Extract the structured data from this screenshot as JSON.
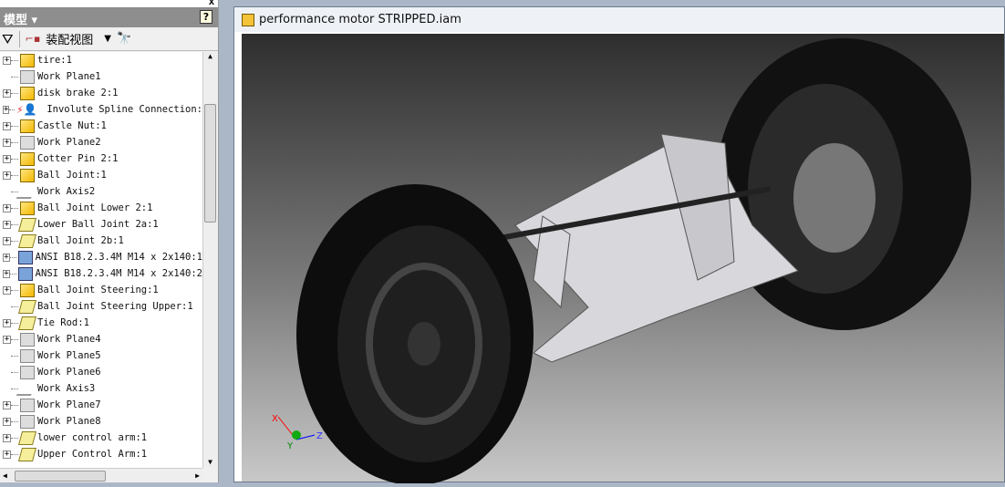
{
  "panel": {
    "title": "模型",
    "help": "?",
    "close": "x",
    "toolbar": {
      "view_label": "装配视图"
    }
  },
  "tree": [
    {
      "label": "tire:1",
      "icon": "part",
      "exp": true
    },
    {
      "label": "Work Plane1",
      "icon": "plane",
      "exp": false
    },
    {
      "label": "disk brake 2:1",
      "icon": "part",
      "exp": true
    },
    {
      "label": "Involute Spline Connection:",
      "icon": "design-accelerator",
      "exp": true
    },
    {
      "label": "Castle Nut:1",
      "icon": "part",
      "exp": true
    },
    {
      "label": "Work Plane2",
      "icon": "plane",
      "exp": true
    },
    {
      "label": "Cotter Pin 2:1",
      "icon": "part",
      "exp": true
    },
    {
      "label": "Ball Joint:1",
      "icon": "part",
      "exp": true
    },
    {
      "label": "Work Axis2",
      "icon": "axis",
      "exp": false
    },
    {
      "label": "Ball Joint Lower 2:1",
      "icon": "part",
      "exp": true
    },
    {
      "label": "Lower Ball Joint 2a:1",
      "icon": "flex",
      "exp": true
    },
    {
      "label": "Ball Joint 2b:1",
      "icon": "flex",
      "exp": true
    },
    {
      "label": "ANSI B18.2.3.4M M14 x 2x140:1",
      "icon": "bolt",
      "exp": true
    },
    {
      "label": "ANSI B18.2.3.4M M14 x 2x140:2",
      "icon": "bolt",
      "exp": true
    },
    {
      "label": "Ball Joint Steering:1",
      "icon": "part",
      "exp": true
    },
    {
      "label": "Ball Joint Steering Upper:1",
      "icon": "flex",
      "exp": false
    },
    {
      "label": "Tie Rod:1",
      "icon": "flex",
      "exp": true
    },
    {
      "label": "Work Plane4",
      "icon": "plane",
      "exp": true
    },
    {
      "label": "Work Plane5",
      "icon": "plane",
      "exp": false
    },
    {
      "label": "Work Plane6",
      "icon": "plane",
      "exp": false
    },
    {
      "label": "Work Axis3",
      "icon": "axis",
      "exp": false
    },
    {
      "label": "Work Plane7",
      "icon": "plane",
      "exp": true
    },
    {
      "label": "Work Plane8",
      "icon": "plane",
      "exp": true
    },
    {
      "label": "lower control arm:1",
      "icon": "flex",
      "exp": true
    },
    {
      "label": "Upper Control Arm:1",
      "icon": "flex",
      "exp": true
    }
  ],
  "document": {
    "title": "performance motor STRIPPED.iam"
  },
  "triad": {
    "x": "X",
    "y": "Y",
    "z": "Z"
  }
}
